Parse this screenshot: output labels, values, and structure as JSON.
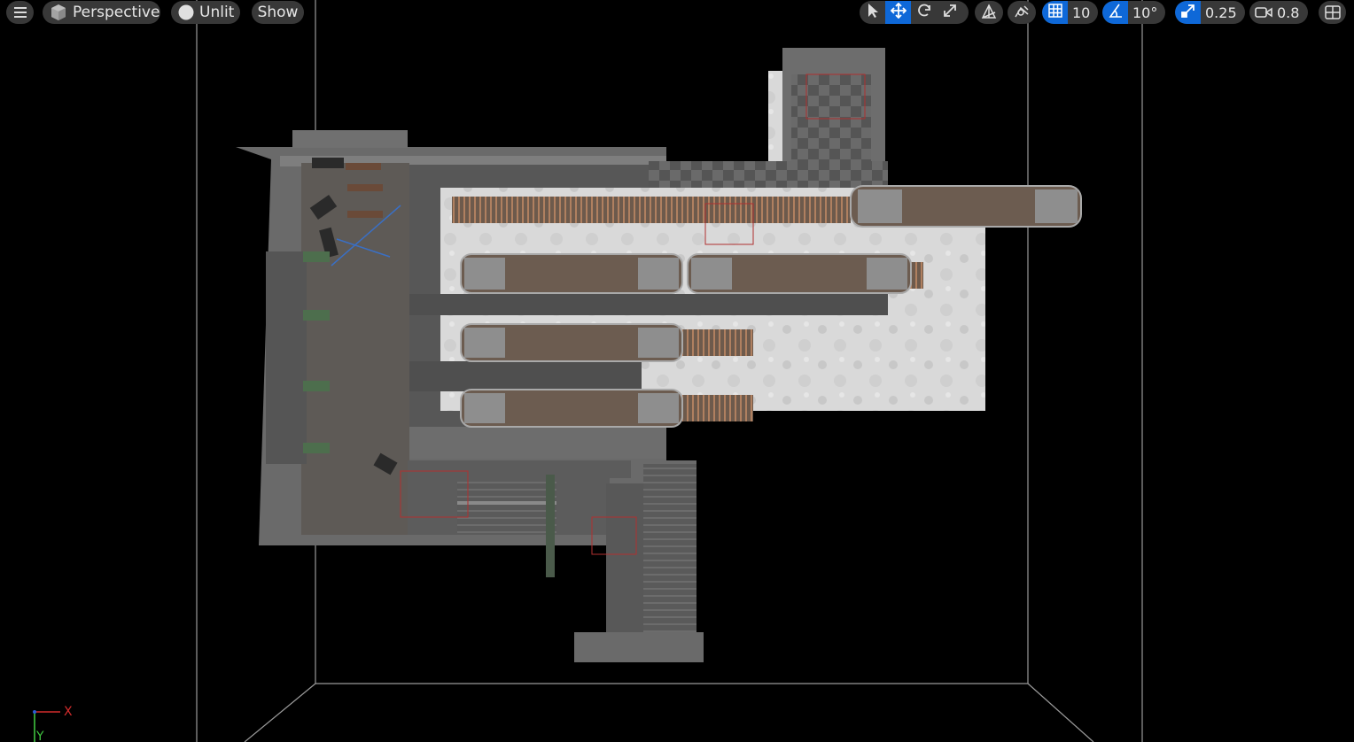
{
  "toolbar": {
    "menu_icon": "hamburger-menu-icon",
    "view_mode": {
      "icon": "perspective-cube-icon",
      "label": "Perspective"
    },
    "lighting": {
      "icon": "unlit-sphere-icon",
      "label": "Unlit"
    },
    "show": {
      "label": "Show"
    },
    "transform_tools": [
      "select-arrow-icon",
      "translate-move-icon",
      "rotate-icon",
      "scale-icon"
    ],
    "active_tool": "translate-move-icon",
    "world_local_icon": "world-space-icon",
    "surface_snap_icon": "surface-snapping-icon",
    "grid_snap": {
      "icon": "grid-snap-icon",
      "value": "10",
      "enabled": true
    },
    "rotation_snap": {
      "icon": "angle-snap-icon",
      "value": "10°",
      "enabled": true
    },
    "scale_snap": {
      "icon": "scale-snap-icon",
      "value": "0.25",
      "enabled": true
    },
    "camera_speed": {
      "icon": "camera-icon",
      "value": "0.8"
    },
    "layout_icon": "viewport-layout-icon",
    "accent_color": "#0e68d8"
  },
  "axis_gizmo": {
    "x_label": "X",
    "y_label": "Y",
    "x_color": "#d42c2c",
    "y_color": "#3fc43f",
    "z_color": "#2c5bd4"
  }
}
